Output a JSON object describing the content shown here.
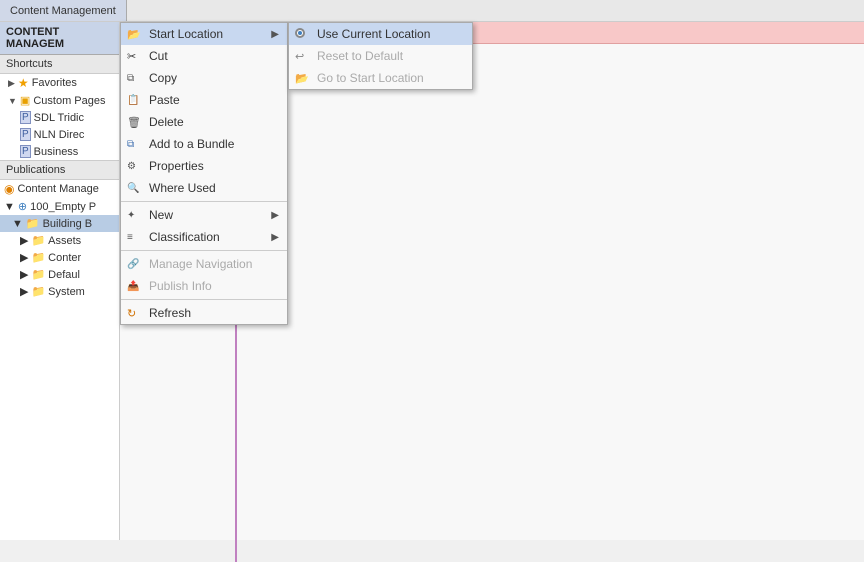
{
  "topBar": {
    "tab": "Content Management"
  },
  "leftPanel": {
    "header": "CONTENT MANAGEM",
    "shortcuts": "Shortcuts",
    "tree": {
      "favorites": "Favorites",
      "customPages": "Custom Pages",
      "items": [
        {
          "label": "SDL Tridic",
          "type": "page"
        },
        {
          "label": "NLN Direc",
          "type": "page"
        },
        {
          "label": "Business",
          "type": "page"
        }
      ]
    },
    "publications": "Publications",
    "pubTree": [
      {
        "label": "Content Manage",
        "type": "content"
      },
      {
        "label": "100_Empty P",
        "type": "globe"
      },
      {
        "label": "Building B",
        "type": "folder"
      },
      {
        "label": "Assets",
        "type": "folder"
      },
      {
        "label": "Conter",
        "type": "folder"
      },
      {
        "label": "Defaul",
        "type": "folder"
      },
      {
        "label": "System",
        "type": "folder"
      }
    ]
  },
  "contextMenu": {
    "items": [
      {
        "id": "start-location",
        "label": "Start Location",
        "icon": "folder",
        "hasArrow": true,
        "disabled": false
      },
      {
        "id": "cut",
        "label": "Cut",
        "icon": "scissors",
        "hasArrow": false,
        "disabled": false
      },
      {
        "id": "copy",
        "label": "Copy",
        "icon": "copy",
        "hasArrow": false,
        "disabled": false
      },
      {
        "id": "paste",
        "label": "Paste",
        "icon": "paste",
        "hasArrow": false,
        "disabled": false
      },
      {
        "id": "delete",
        "label": "Delete",
        "icon": "delete",
        "hasArrow": false,
        "disabled": false
      },
      {
        "id": "add-to-bundle",
        "label": "Add to a Bundle",
        "icon": "bundle",
        "hasArrow": false,
        "disabled": false
      },
      {
        "id": "properties",
        "label": "Properties",
        "icon": "properties",
        "hasArrow": false,
        "disabled": false
      },
      {
        "id": "where-used",
        "label": "Where Used",
        "icon": "whereused",
        "hasArrow": false,
        "disabled": false
      },
      {
        "id": "new",
        "label": "New",
        "icon": "new",
        "hasArrow": true,
        "disabled": false
      },
      {
        "id": "classification",
        "label": "Classification",
        "icon": "classification",
        "hasArrow": true,
        "disabled": false
      },
      {
        "id": "manage-nav",
        "label": "Manage Navigation",
        "icon": "nav",
        "hasArrow": false,
        "disabled": true
      },
      {
        "id": "publish-info",
        "label": "Publish Info",
        "icon": "publish",
        "hasArrow": false,
        "disabled": true
      },
      {
        "id": "refresh",
        "label": "Refresh",
        "icon": "refresh",
        "hasArrow": false,
        "disabled": false
      }
    ],
    "subMenu": {
      "items": [
        {
          "id": "use-current",
          "label": "Use Current Location",
          "icon": "radio-checked",
          "disabled": false,
          "highlighted": true
        },
        {
          "id": "reset-default",
          "label": "Reset to Default",
          "icon": "undo",
          "disabled": true
        },
        {
          "id": "go-to-start",
          "label": "Go to Start Location",
          "icon": "goto",
          "disabled": true
        }
      ]
    }
  }
}
